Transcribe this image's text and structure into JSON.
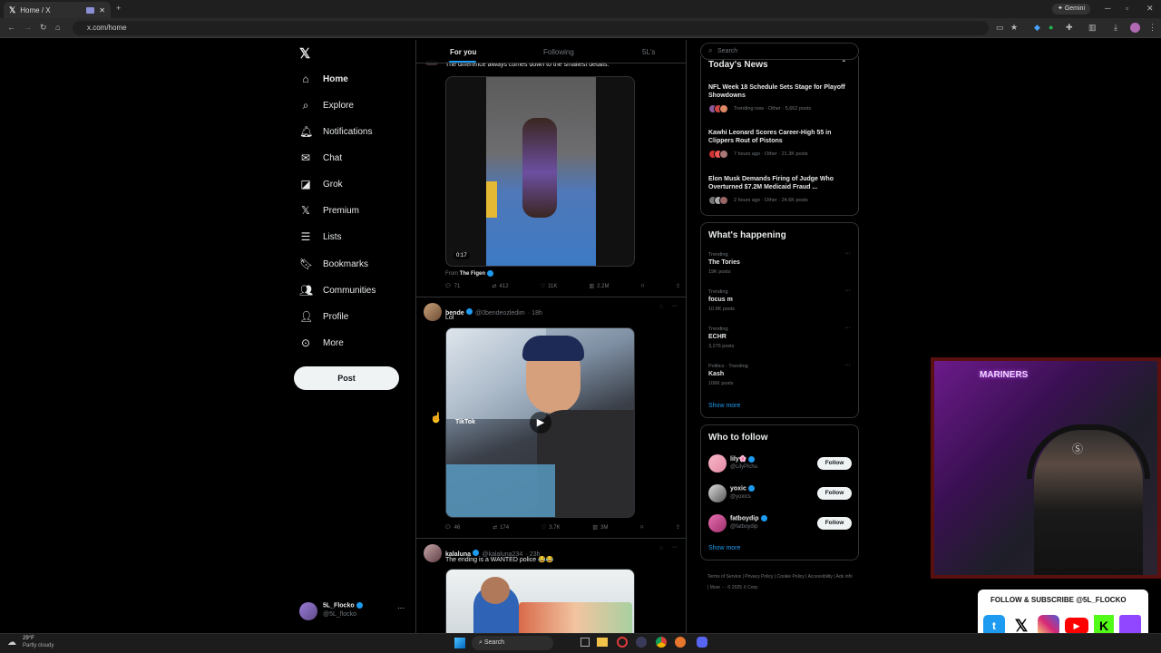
{
  "browser": {
    "tab_title": "Home / X",
    "url": "x.com/home",
    "gemini_label": "Gemini"
  },
  "nav": {
    "items": [
      {
        "label": "Home",
        "icon": "home-icon"
      },
      {
        "label": "Explore",
        "icon": "search-icon"
      },
      {
        "label": "Notifications",
        "icon": "bell-icon"
      },
      {
        "label": "Chat",
        "icon": "mail-icon"
      },
      {
        "label": "Grok",
        "icon": "grok-icon"
      },
      {
        "label": "Premium",
        "icon": "x-logo-icon"
      },
      {
        "label": "Lists",
        "icon": "list-icon"
      },
      {
        "label": "Bookmarks",
        "icon": "bookmark-icon"
      },
      {
        "label": "Communities",
        "icon": "communities-icon"
      },
      {
        "label": "Profile",
        "icon": "person-icon"
      },
      {
        "label": "More",
        "icon": "more-circle-icon"
      }
    ],
    "post_label": "Post",
    "account_name": "5L_Flocko",
    "account_handle": "@5L_flocko"
  },
  "feed": {
    "tabs": [
      "For you",
      "Following",
      "5L's"
    ],
    "tweet1": {
      "text": "The difference always comes down to the smallest details.",
      "video_time": "0:17",
      "from_label": "From",
      "from_name": "The Figen",
      "replies": "71",
      "reposts": "412",
      "likes": "11K",
      "views": "2.2M"
    },
    "tweet2": {
      "name": "bende",
      "handle": "@0bendeozledim",
      "time": "· 18h",
      "text": "Lol",
      "replies": "46",
      "reposts": "174",
      "likes": "3.7K",
      "views": "3M",
      "watermark": "TikTok"
    },
    "tweet3": {
      "name": "kalaluna",
      "handle": "@kalaluna234",
      "time": "· 23h",
      "text": "The ending is a WANTED police 😂😂"
    }
  },
  "right": {
    "search_placeholder": "Search",
    "news_title": "Today's News",
    "news": [
      {
        "title": "NFL Week 18 Schedule Sets Stage for Playoff Showdowns",
        "meta": "Trending now · Other · 5,662 posts"
      },
      {
        "title": "Kawhi Leonard Scores Career-High 55 in Clippers Rout of Pistons",
        "meta": "7 hours ago · Other · 21.3K posts"
      },
      {
        "title": "Elon Musk Demands Firing of Judge Who Overturned $7.2M Medicaid Fraud ...",
        "meta": "2 hours ago · Other · 24.6K posts"
      }
    ],
    "happening_title": "What's happening",
    "trends": [
      {
        "category": "Trending",
        "name": "The Tories",
        "count": "19K posts"
      },
      {
        "category": "Trending",
        "name": "focus m",
        "count": "10.8K posts"
      },
      {
        "category": "Trending",
        "name": "ECHR",
        "count": "3,276 posts"
      },
      {
        "category": "Politics · Trending",
        "name": "Kash",
        "count": "106K posts"
      }
    ],
    "show_more": "Show more",
    "wtf_title": "Who to follow",
    "follow_label": "Follow",
    "who_to_follow": [
      {
        "name": "lily🌸",
        "handle": "@LilyPichu"
      },
      {
        "name": "yoxic",
        "handle": "@yoxics"
      },
      {
        "name": "fatboydip",
        "handle": "@fatboydip"
      }
    ],
    "footer": "Terms of Service | Privacy Policy | Cookie Policy | Accessibility | Ads info | More ··· © 2025 X Corp."
  },
  "overlay": {
    "follow_text": "FOLLOW & SUBSCRIBE @5L_FLOCKO",
    "sign_text": "MARINERS"
  },
  "taskbar": {
    "weather_temp": "29°F",
    "weather_desc": "Partly cloudy",
    "search_label": "Search"
  }
}
